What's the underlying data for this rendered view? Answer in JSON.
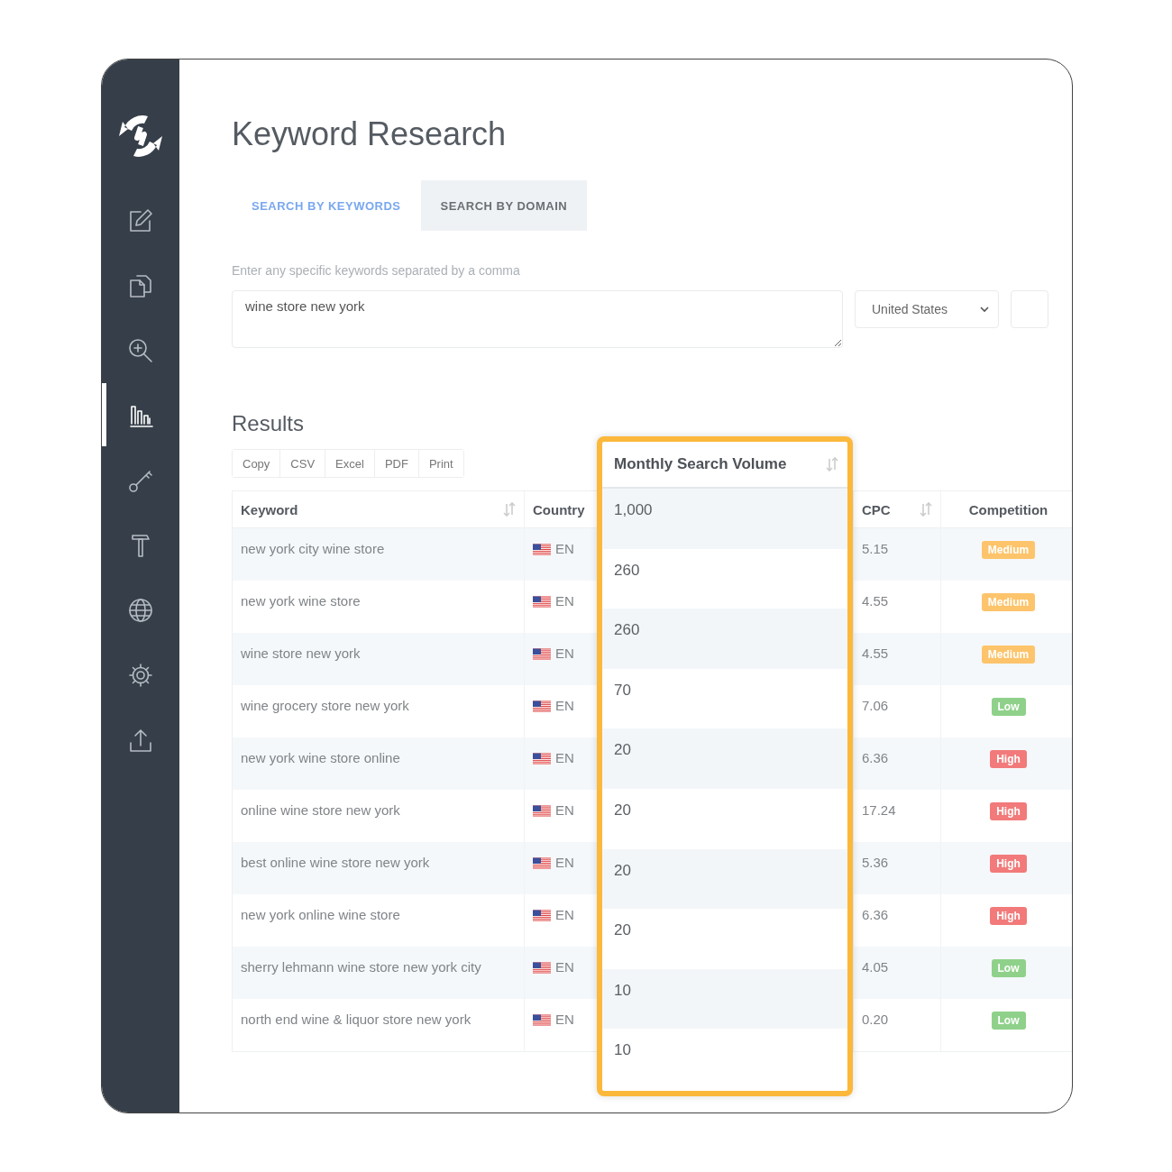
{
  "sidebar": {
    "items": [
      {
        "selected": false
      },
      {
        "selected": false
      },
      {
        "selected": false
      },
      {
        "selected": true
      },
      {
        "selected": false
      },
      {
        "selected": false
      },
      {
        "selected": false
      },
      {
        "selected": false
      },
      {
        "selected": false
      }
    ]
  },
  "page_title": "Keyword Research",
  "tabs": [
    {
      "label": "SEARCH BY KEYWORDS",
      "selected": true
    },
    {
      "label": "SEARCH BY DOMAIN",
      "selected": false
    }
  ],
  "search": {
    "label": "Enter any specific keywords separated by a comma",
    "value": "wine store new york",
    "country": "United States"
  },
  "results": {
    "title": "Results",
    "export_buttons": [
      "Copy",
      "CSV",
      "Excel",
      "PDF",
      "Print"
    ],
    "columns": [
      {
        "label": "Keyword",
        "sortable": true
      },
      {
        "label": "Country",
        "sortable": false
      },
      {
        "label": "CPC",
        "sortable": true
      },
      {
        "label": "Competition",
        "sortable": false
      }
    ],
    "rows": [
      {
        "keyword": "new york city wine store",
        "country": "EN",
        "cpc": "5.15",
        "competition": {
          "label": "Medium",
          "color": "#fdc46b"
        }
      },
      {
        "keyword": "new york wine store",
        "country": "EN",
        "cpc": "4.55",
        "competition": {
          "label": "Medium",
          "color": "#fdc46b"
        }
      },
      {
        "keyword": "wine store new york",
        "country": "EN",
        "cpc": "4.55",
        "competition": {
          "label": "Medium",
          "color": "#fdc46b"
        }
      },
      {
        "keyword": "wine grocery store new york",
        "country": "EN",
        "cpc": "7.06",
        "competition": {
          "label": "Low",
          "color": "#8fd18a"
        }
      },
      {
        "keyword": "new york wine store online",
        "country": "EN",
        "cpc": "6.36",
        "competition": {
          "label": "High",
          "color": "#f27a7a"
        }
      },
      {
        "keyword": "online wine store new york",
        "country": "EN",
        "cpc": "17.24",
        "competition": {
          "label": "High",
          "color": "#f27a7a"
        }
      },
      {
        "keyword": "best online wine store new york",
        "country": "EN",
        "cpc": "5.36",
        "competition": {
          "label": "High",
          "color": "#f27a7a"
        }
      },
      {
        "keyword": "new york online wine store",
        "country": "EN",
        "cpc": "6.36",
        "competition": {
          "label": "High",
          "color": "#f27a7a"
        }
      },
      {
        "keyword": "sherry lehmann wine store new york city",
        "country": "EN",
        "cpc": "4.05",
        "competition": {
          "label": "Low",
          "color": "#8fd18a"
        }
      },
      {
        "keyword": "north end wine & liquor store new york",
        "country": "EN",
        "cpc": "0.20",
        "competition": {
          "label": "Low",
          "color": "#8fd18a"
        }
      }
    ]
  },
  "highlight_column": {
    "title": "Monthly Search Volume",
    "values": [
      "1,000",
      "260",
      "260",
      "70",
      "20",
      "20",
      "20",
      "20",
      "10",
      "10"
    ]
  }
}
